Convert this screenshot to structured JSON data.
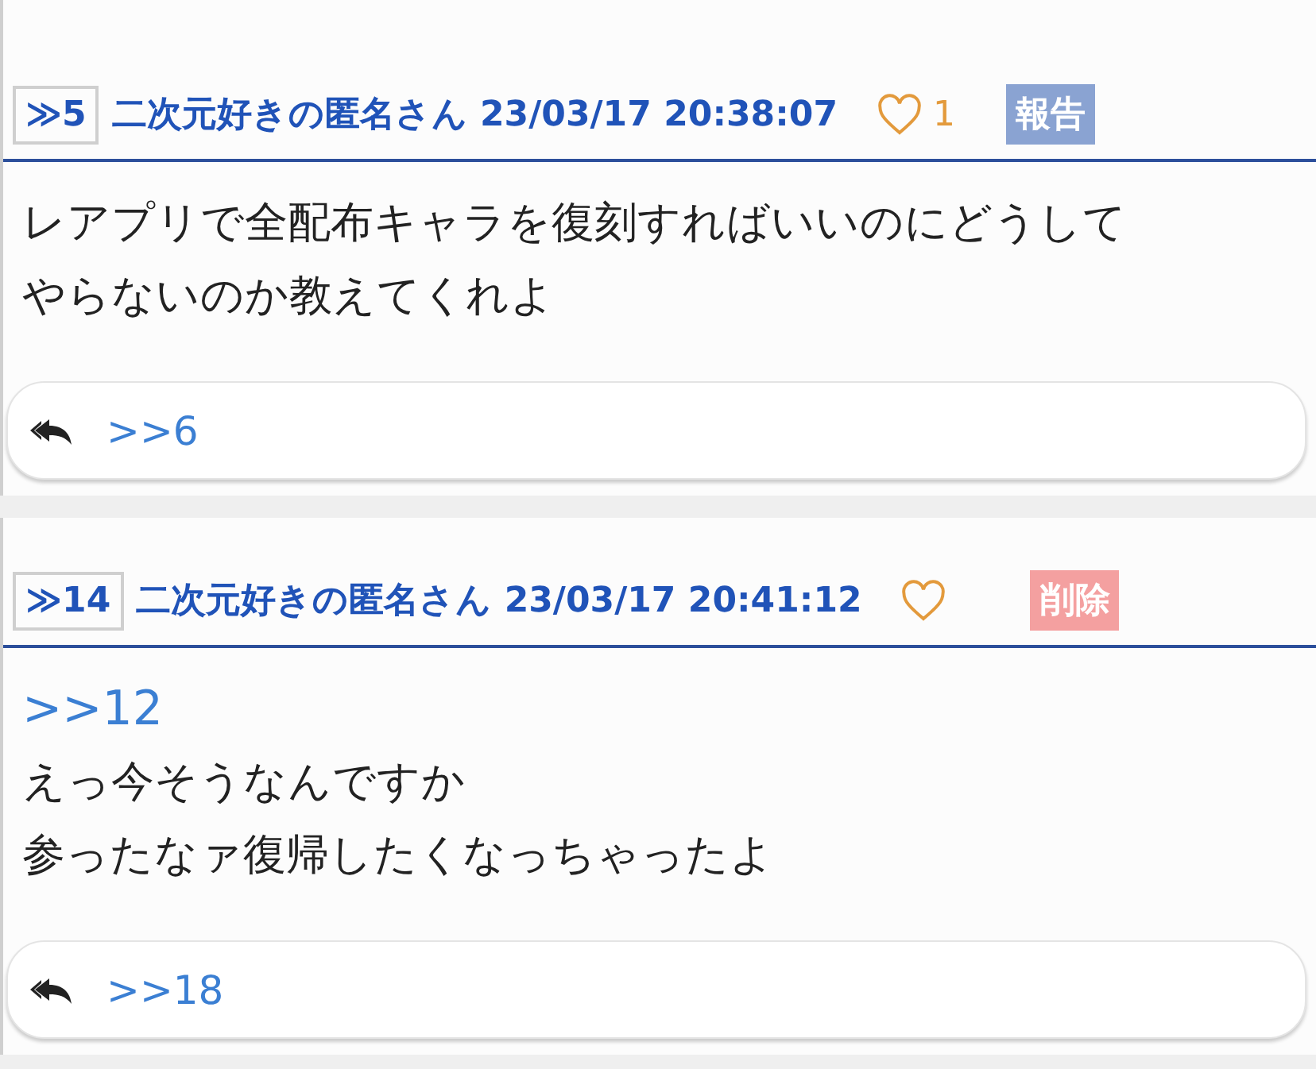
{
  "posts": [
    {
      "number": "≫5",
      "name": "二次元好きの匿名さん",
      "date": "23/03/17 20:38:07",
      "likes": "1",
      "action": {
        "kind": "report",
        "label": "報告"
      },
      "body": [
        "レアプリで全配布キャラを復刻すればいいのにどうして",
        "やらないのか教えてくれよ"
      ],
      "replies": [
        ">>6"
      ]
    },
    {
      "number": "≫14",
      "name": "二次元好きの匿名さん",
      "date": "23/03/17 20:41:12",
      "action": {
        "kind": "delete",
        "label": "削除"
      },
      "anchors": [
        ">>12"
      ],
      "body": [
        "えっ今そうなんですか",
        "参ったなァ復帰したくなっちゃったよ"
      ],
      "replies": [
        ">>18"
      ]
    }
  ]
}
